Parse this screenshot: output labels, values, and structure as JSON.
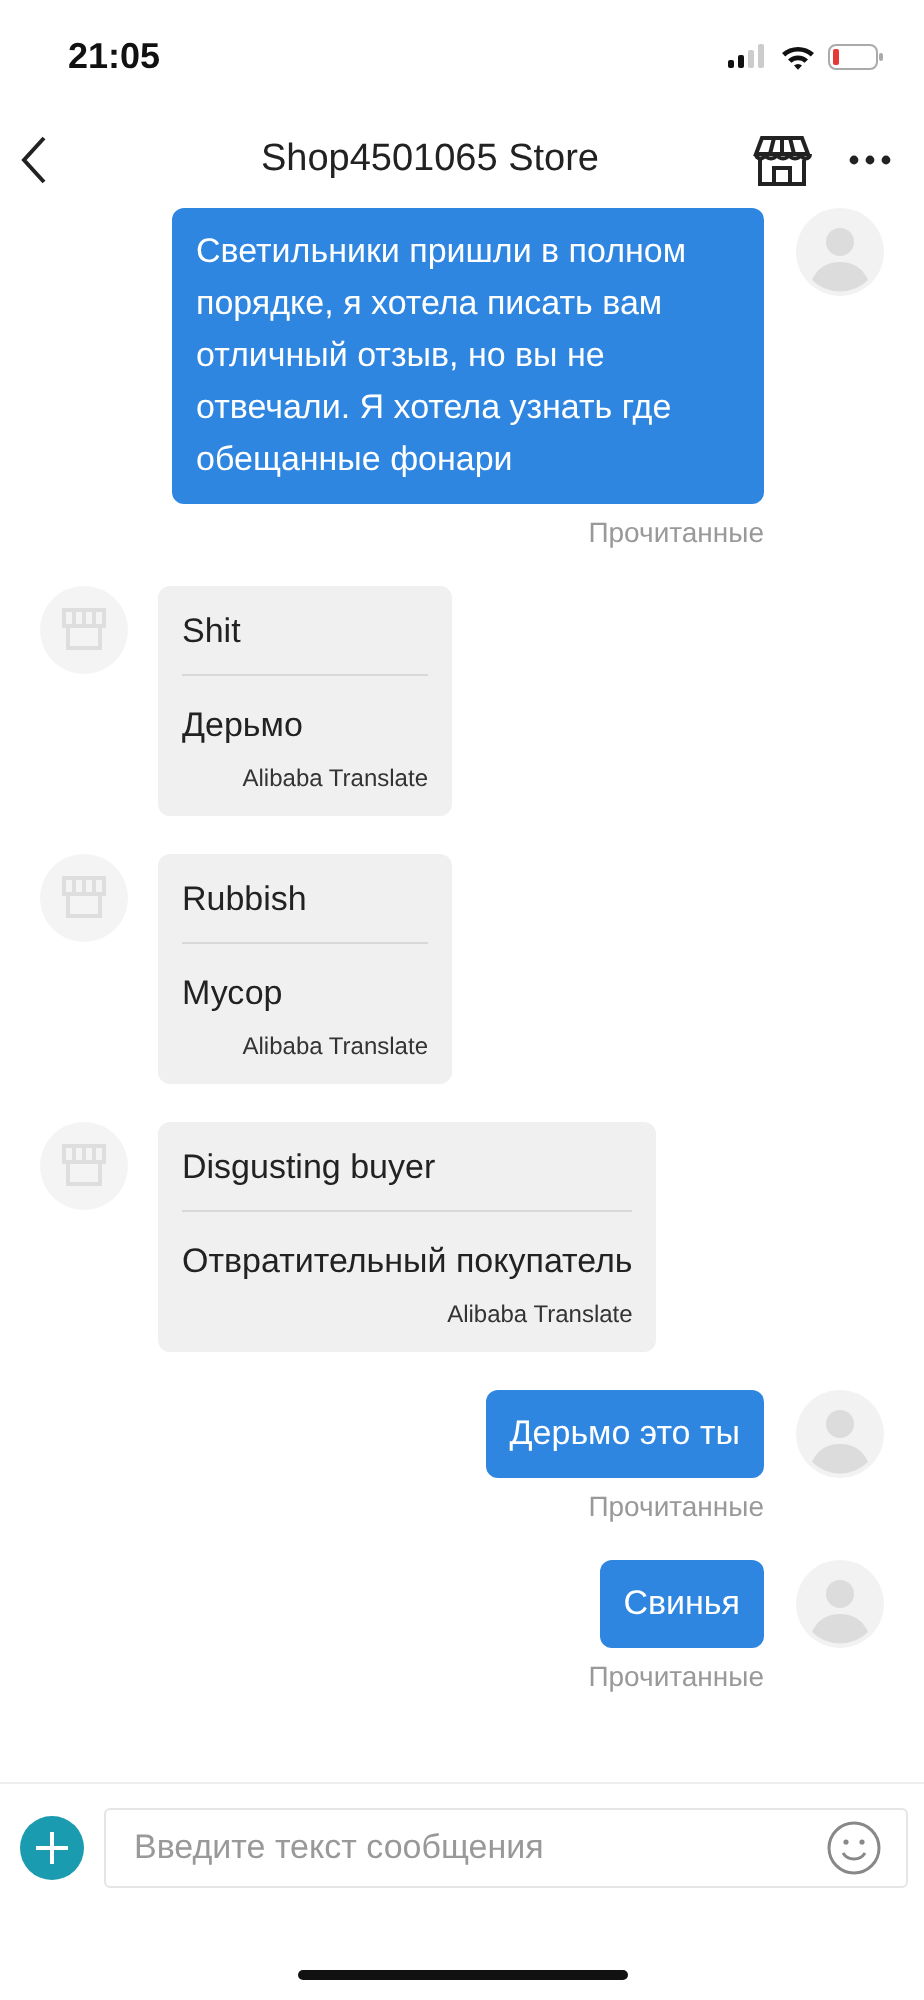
{
  "status_bar": {
    "time": "21:05"
  },
  "header": {
    "title": "Shop4501065 Store"
  },
  "messages": [
    {
      "kind": "sent",
      "text": "Светильники пришли в полном порядке, я хотела писать вам отличный отзыв, но вы не отвечали. Я хотела узнать где обещанные фонари",
      "status": "Прочитанные"
    },
    {
      "kind": "translated",
      "original": "Shit",
      "translation": "Дерьмо",
      "translator": "Alibaba Translate"
    },
    {
      "kind": "translated",
      "original": "Rubbish",
      "translation": "Мусор",
      "translator": "Alibaba Translate"
    },
    {
      "kind": "translated",
      "original": "Disgusting buyer",
      "translation": "Отвратительный покупатель",
      "translator": "Alibaba Translate"
    },
    {
      "kind": "sent",
      "text": "Дерьмо это ты",
      "status": "Прочитанные"
    },
    {
      "kind": "sent",
      "text": "Свинья",
      "status": "Прочитанные"
    }
  ],
  "composer": {
    "placeholder": "Введите текст сообщения"
  }
}
